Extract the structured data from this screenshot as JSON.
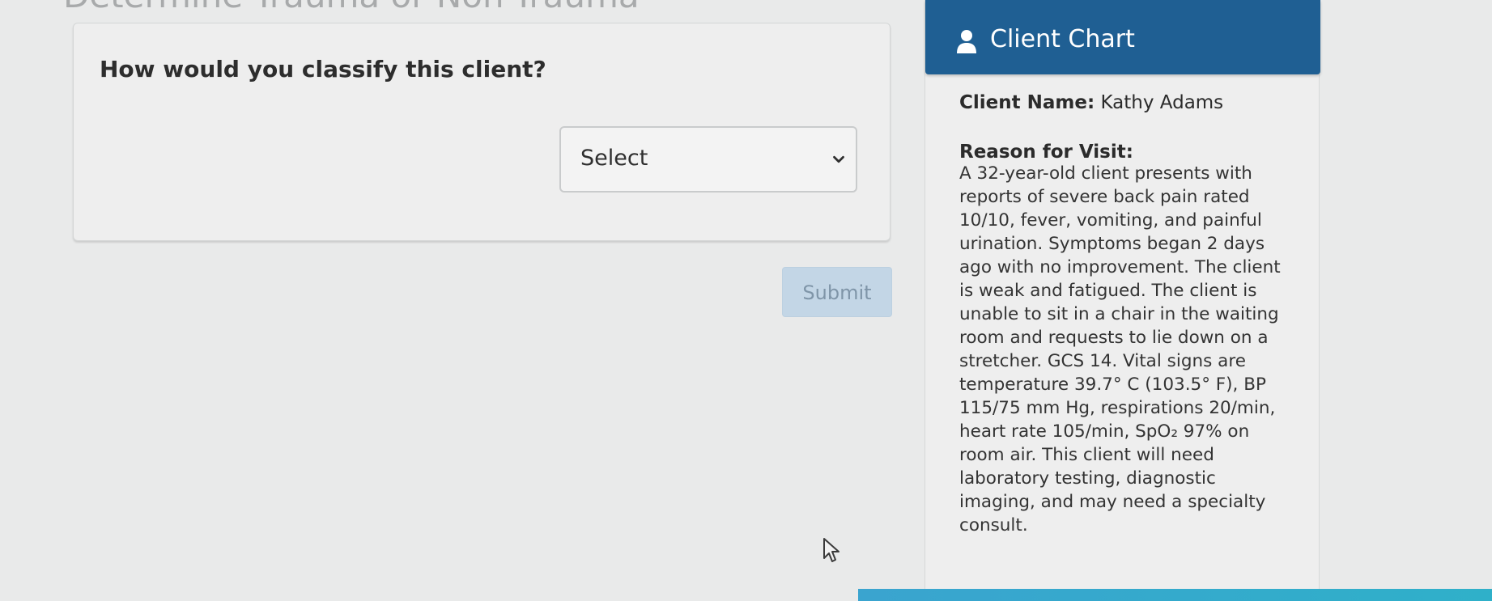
{
  "page": {
    "heading": "Determine Trauma or Non-Trauma"
  },
  "question": {
    "text": "How would you classify this client?",
    "select": {
      "value": "Select",
      "icon": "chevron-down-icon"
    },
    "submit_label": "Submit"
  },
  "client_chart": {
    "title": "Client Chart",
    "icon": "person-icon",
    "client_name_label": "Client Name:",
    "client_name": "Kathy Adams",
    "reason_label": "Reason for Visit:",
    "reason_text": [
      "A 32-year-old client presents with",
      "reports of severe back pain rated",
      "10/10, fever, vomiting, and painful",
      "urination. Symptoms began 2 days",
      "ago with no improvement. The client",
      "is weak and fatigued. The client is",
      "unable to sit in a chair in the waiting",
      "room and requests to lie down on a",
      "stretcher. GCS 14. Vital signs are",
      "temperature 39.7° C (103.5° F), BP",
      "115/75 mm Hg, respirations 20/min,",
      "heart rate 105/min, SpO₂ 97% on",
      "room air. This client will need",
      "laboratory testing, diagnostic",
      "imaging, and may need a specialty",
      "consult."
    ]
  },
  "colors": {
    "header": "#1f5f93",
    "submit_disabled": "#c3d6e6",
    "background": "#e9eaea"
  }
}
